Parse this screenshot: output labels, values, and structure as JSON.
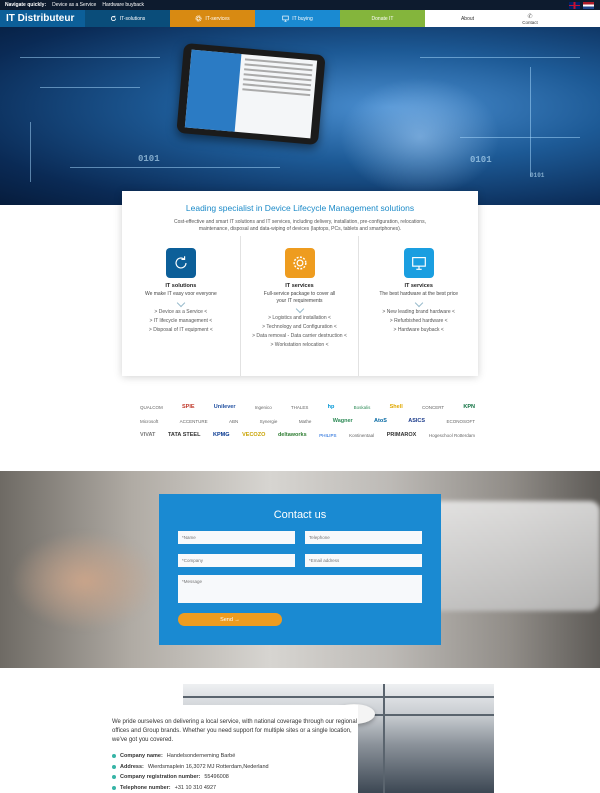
{
  "topbar": {
    "label": "Navigate quickly:",
    "links": [
      "Device as a Service",
      "Hardware buyback"
    ]
  },
  "nav": {
    "brand": "IT Distributeur",
    "items": [
      {
        "label": "IT-solutions",
        "icon": "refresh-icon",
        "color": "#0a4d7a"
      },
      {
        "label": "IT-services",
        "icon": "gear-icon",
        "color": "#d88a12"
      },
      {
        "label": "IT buying",
        "icon": "monitor-icon",
        "color": "#1a8ad2"
      },
      {
        "label": "Donate IT",
        "icon": "",
        "color": "#84b53c"
      },
      {
        "label": "About",
        "icon": "",
        "color": "#ffffff"
      }
    ],
    "contact": "Contact"
  },
  "card": {
    "title": "Leading specialist in Device Lifecycle Management solutions",
    "intro": "Cost-effective and smart IT solutions and IT services, including delivery, installation, pre-configuration, relocations, maintenance, disposal and data-wiping of devices (laptops, PCs, tablets and smartphones).",
    "columns": [
      {
        "title": "IT solutions",
        "tagline": "We make IT easy voor everyone",
        "icon": "refresh-icon",
        "color": "#0c5f99",
        "links": [
          "> Device as a Service <",
          "> IT lifecycle management <",
          "> Disposal of IT equipment <"
        ]
      },
      {
        "title": "IT services",
        "tagline": "Full-service package to cover all your IT requirements",
        "icon": "gear-icon",
        "color": "#ee9c1f",
        "links": [
          "> Logistics and installation <",
          "> Technology and Configuration <",
          "> Data removal - Data carrier destruction <",
          "> Workstation relocation <"
        ]
      },
      {
        "title": "IT services",
        "tagline": "The best hardware at the best price",
        "icon": "monitor-icon",
        "color": "#1a9ee0",
        "links": [
          "> New leading brand hardware <",
          "> Refurbished hardware <",
          "> Hardware buyback <"
        ]
      }
    ]
  },
  "partner_logos": [
    [
      "QUALCOM",
      "SPIE",
      "Unilever",
      "Ingenico",
      "THALES",
      "hp",
      "Boskalis",
      "Shell",
      "CONCERT",
      "KPN"
    ],
    [
      "Microsoft",
      "ACCENTURE",
      "ABN",
      "Synergie",
      "Mathe",
      "Wagner",
      "AtoS",
      "ASICS",
      "ECONOSOFT",
      ""
    ],
    [
      "VIVAT",
      "TATA STEEL",
      "KPMG",
      "VECOZO",
      "deltaworks",
      "PHILIPS",
      "Kontinentaal",
      "PRIMAROX",
      "Hogeschool Rotterdam"
    ]
  ],
  "contact": {
    "title": "Contact us",
    "name_placeholder": "*Name",
    "telephone_placeholder": "Telephone",
    "company_placeholder": "*Company",
    "email_placeholder": "*Email address",
    "message_placeholder": "*Message",
    "send_label": "Send →"
  },
  "about": {
    "text": "We pride ourselves on delivering a local service, with national coverage through our regional offices and Group brands. Whether you need support for multiple sites or a single location, we've got you covered.",
    "details": [
      {
        "label": "Company name:",
        "value": "Handelsonderneming Barbé"
      },
      {
        "label": "Address:",
        "value": "Wierdsmaplein 16,3072 MJ Rotterdam,Nederland"
      },
      {
        "label": "Company registration number:",
        "value": "55496008"
      },
      {
        "label": "Telephone number:",
        "value": "+31 10 310 4927"
      }
    ]
  },
  "colors": {
    "brand_blue": "#0c5f99",
    "orange": "#ee9c1f",
    "light_blue": "#1a8ad2",
    "green": "#84b53c",
    "teal_dot": "#36b4a6"
  }
}
